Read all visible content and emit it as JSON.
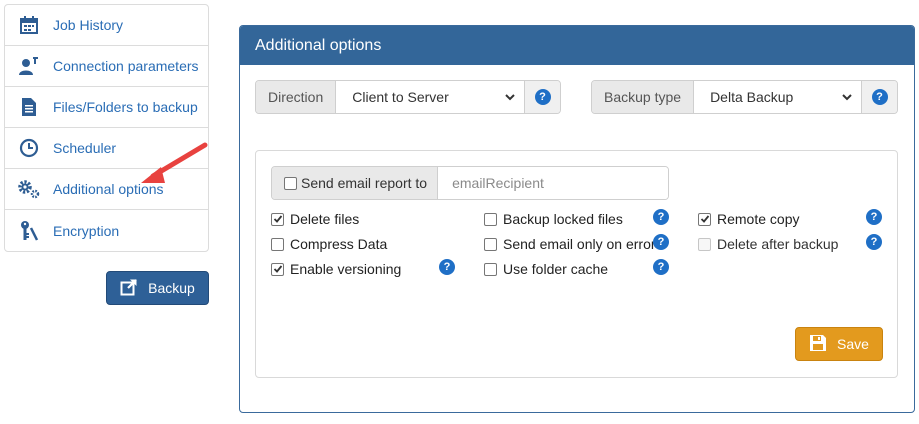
{
  "sidebar": {
    "items": [
      {
        "label": "Job History",
        "icon": "calendar-icon"
      },
      {
        "label": "Connection parameters",
        "icon": "user-network-icon"
      },
      {
        "label": "Files/Folders to backup",
        "icon": "document-icon"
      },
      {
        "label": "Scheduler",
        "icon": "clock-icon"
      },
      {
        "label": "Additional options",
        "icon": "gears-icon"
      },
      {
        "label": "Encryption",
        "icon": "key-icon"
      }
    ]
  },
  "backup_button": {
    "label": "Backup",
    "icon": "external-link-icon"
  },
  "panel": {
    "title": "Additional options",
    "direction": {
      "label": "Direction",
      "value": "Client to Server"
    },
    "backup_type": {
      "label": "Backup type",
      "value": "Delta Backup"
    },
    "email": {
      "label": "Send email report to",
      "checked": false,
      "placeholder": "emailRecipient"
    },
    "options": {
      "delete_files": {
        "label": "Delete files",
        "checked": true
      },
      "compress_data": {
        "label": "Compress Data",
        "checked": false
      },
      "enable_versioning": {
        "label": "Enable versioning",
        "checked": true
      },
      "backup_locked_files": {
        "label": "Backup locked files",
        "checked": false
      },
      "send_email_only_on_error": {
        "label": "Send email only on error",
        "checked": false
      },
      "use_folder_cache": {
        "label": "Use folder cache",
        "checked": false
      },
      "remote_copy": {
        "label": "Remote copy",
        "checked": true
      },
      "delete_after_backup": {
        "label": "Delete after backup",
        "checked": false,
        "disabled": true
      }
    },
    "save_button": {
      "label": "Save",
      "icon": "floppy-disk-icon"
    }
  },
  "colors": {
    "accent": "#336699",
    "link": "#2a6db5",
    "save": "#e39a1e",
    "annotation_arrow": "#e8423f"
  }
}
